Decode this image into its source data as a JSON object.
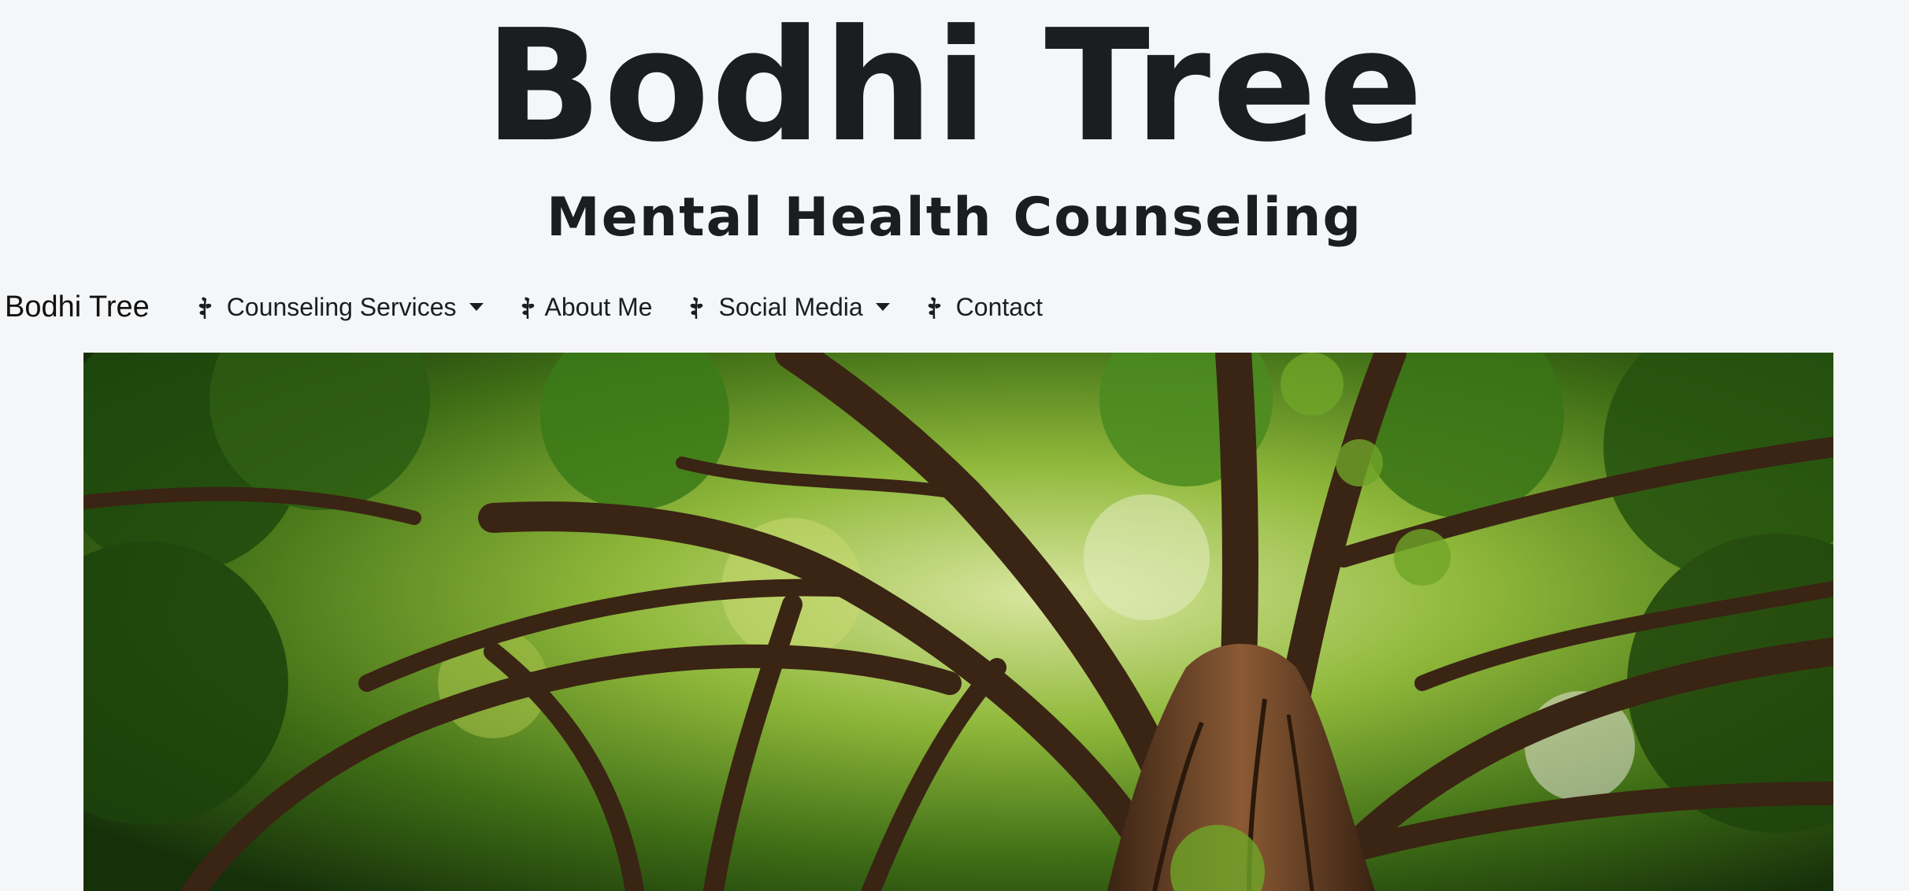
{
  "header": {
    "title": "Bodhi Tree",
    "subtitle": "Mental Health Counseling"
  },
  "navbar": {
    "brand": "Bodhi Tree",
    "items": [
      {
        "label": "Counseling Services",
        "icon": "leaf-icon",
        "dropdown": true
      },
      {
        "label": "About Me",
        "icon": "leaf-icon",
        "dropdown": false
      },
      {
        "label": "Social Media",
        "icon": "leaf-icon",
        "dropdown": true
      },
      {
        "label": "Contact",
        "icon": "leaf-icon",
        "dropdown": false
      }
    ]
  },
  "hero_image": {
    "subject": "tree-canopy-photo"
  },
  "colors": {
    "background": "#f5f6f8",
    "text": "#1b1e21",
    "foliage_dark": "#1f3d0c",
    "foliage_light": "#7fae2a",
    "trunk": "#5a3a22"
  }
}
